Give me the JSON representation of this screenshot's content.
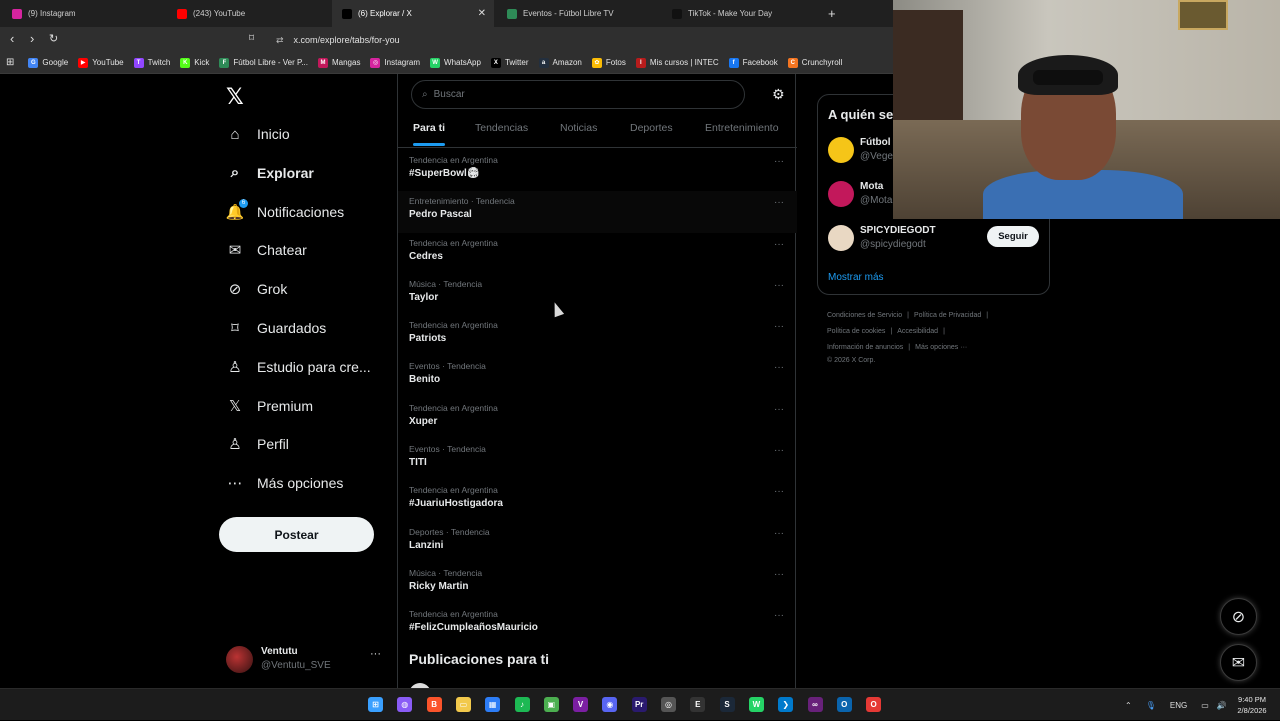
{
  "browser": {
    "tabs": [
      {
        "label": "(9) Instagram",
        "icon": "instagram-icon",
        "color": "#d6249f"
      },
      {
        "label": "(243) YouTube",
        "icon": "youtube-icon",
        "color": "#ff0000"
      },
      {
        "label": "(6) Explorar / X",
        "icon": "x-icon",
        "color": "#000000",
        "active": true,
        "close": "✕"
      },
      {
        "label": "Eventos - Fútbol Libre TV",
        "icon": "futbol-libre-icon",
        "color": "#2e8b57"
      },
      {
        "label": "TikTok - Make Your Day",
        "icon": "tiktok-icon",
        "color": "#111111"
      }
    ],
    "new_tab": "+",
    "url": "x.com/explore/tabs/for-you",
    "bookmarks": [
      {
        "label": "Google",
        "color": "#4285f4",
        "glyph": "G"
      },
      {
        "label": "YouTube",
        "color": "#ff0000",
        "glyph": "▶"
      },
      {
        "label": "Twitch",
        "color": "#9146ff",
        "glyph": "T"
      },
      {
        "label": "Kick",
        "color": "#53fc18",
        "glyph": "K"
      },
      {
        "label": "Fútbol Libre - Ver P...",
        "color": "#2e8b57",
        "glyph": "F"
      },
      {
        "label": "Mangas",
        "color": "#c2185b",
        "glyph": "M"
      },
      {
        "label": "Instagram",
        "color": "#d6249f",
        "glyph": "◎"
      },
      {
        "label": "WhatsApp",
        "color": "#25d366",
        "glyph": "W"
      },
      {
        "label": "Twitter",
        "color": "#000000",
        "glyph": "X"
      },
      {
        "label": "Amazon",
        "color": "#232f3e",
        "glyph": "a"
      },
      {
        "label": "Fotos",
        "color": "#fbbc05",
        "glyph": "✿"
      },
      {
        "label": "Mis cursos | INTEC",
        "color": "#b71c1c",
        "glyph": "I"
      },
      {
        "label": "Facebook",
        "color": "#1877f2",
        "glyph": "f"
      },
      {
        "label": "Crunchyroll",
        "color": "#f47521",
        "glyph": "C"
      }
    ]
  },
  "sidebar": {
    "items": [
      {
        "label": "Inicio",
        "icon": "home-icon",
        "glyph": "⌂"
      },
      {
        "label": "Explorar",
        "icon": "search-icon",
        "glyph": "⌕",
        "active": true
      },
      {
        "label": "Notificaciones",
        "icon": "bell-icon",
        "glyph": "🔔",
        "badge": "6"
      },
      {
        "label": "Chatear",
        "icon": "mail-icon",
        "glyph": "✉"
      },
      {
        "label": "Grok",
        "icon": "grok-icon",
        "glyph": "⊘"
      },
      {
        "label": "Guardados",
        "icon": "bookmark-icon",
        "glyph": "⌑"
      },
      {
        "label": "Estudio para cre...",
        "icon": "creator-studio-icon",
        "glyph": "♙"
      },
      {
        "label": "Premium",
        "icon": "x-premium-icon",
        "glyph": "𝕏"
      },
      {
        "label": "Perfil",
        "icon": "person-icon",
        "glyph": "♙"
      },
      {
        "label": "Más opciones",
        "icon": "more-circle-icon",
        "glyph": "⋯"
      }
    ],
    "post_button": "Postear",
    "account": {
      "name": "Ventutu",
      "handle": "@Ventutu_SVE",
      "more": "···"
    }
  },
  "explore": {
    "search_placeholder": "Buscar",
    "tabs": [
      "Para ti",
      "Tendencias",
      "Noticias",
      "Deportes",
      "Entretenimiento"
    ],
    "trends": [
      {
        "context": "Tendencia en Argentina",
        "name": "#SuperBowl🏟"
      },
      {
        "context": "Entretenimiento · Tendencia",
        "name": "Pedro Pascal"
      },
      {
        "context": "Tendencia en Argentina",
        "name": "Cedres"
      },
      {
        "context": "Música · Tendencia",
        "name": "Taylor"
      },
      {
        "context": "Tendencia en Argentina",
        "name": "Patriots"
      },
      {
        "context": "Eventos · Tendencia",
        "name": "Benito"
      },
      {
        "context": "Tendencia en Argentina",
        "name": "Xuper"
      },
      {
        "context": "Eventos · Tendencia",
        "name": "TITI"
      },
      {
        "context": "Tendencia en Argentina",
        "name": "#JuariuHostigadora"
      },
      {
        "context": "Deportes · Tendencia",
        "name": "Lanzini"
      },
      {
        "context": "Música · Tendencia",
        "name": "Ricky Martin"
      },
      {
        "context": "Tendencia en Argentina",
        "name": "#FelizCumpleañosMauricio"
      }
    ],
    "trend_more": "···",
    "posts_title": "Publicaciones para ti"
  },
  "who_to_follow": {
    "title": "A quién se",
    "accounts": [
      {
        "name": "Fútbol",
        "handle": "@Veget",
        "color": "#f5c518"
      },
      {
        "name": "Mota",
        "handle": "@Mota",
        "color": "#c2185b"
      },
      {
        "name": "SPICYDIEGODT",
        "handle": "@spicydiegodt",
        "color": "#e9d8c3",
        "follow": "Seguir"
      }
    ],
    "show_more": "Mostrar más"
  },
  "footer": {
    "links": [
      "Condiciones de Servicio",
      "Política de Privacidad",
      "Política de cookies",
      "Accesibilidad",
      "Información de anuncios",
      "Más opciones ···"
    ],
    "copyright": "© 2026 X Corp."
  },
  "taskbar": {
    "language": "ENG",
    "time": "9:40 PM",
    "date": "2/8/2026",
    "apps": [
      {
        "name": "windows-start-icon",
        "color": "#3aa0ff",
        "glyph": "⊞"
      },
      {
        "name": "copilot-icon",
        "color": "#8a5cf6",
        "glyph": "◍"
      },
      {
        "name": "brave-icon",
        "color": "#fb542b",
        "glyph": "B"
      },
      {
        "name": "file-explorer-icon",
        "color": "#f2c94c",
        "glyph": "▭"
      },
      {
        "name": "store-icon",
        "color": "#2d7df6",
        "glyph": "▦"
      },
      {
        "name": "spotify-icon",
        "color": "#1db954",
        "glyph": "♪"
      },
      {
        "name": "minecraft-icon",
        "color": "#4caf50",
        "glyph": "▣"
      },
      {
        "name": "vegas-icon",
        "color": "#7b1fa2",
        "glyph": "V"
      },
      {
        "name": "discord-icon",
        "color": "#5865f2",
        "glyph": "◉"
      },
      {
        "name": "premiere-icon",
        "color": "#2a1a6e",
        "glyph": "Pr"
      },
      {
        "name": "chrome-icon",
        "color": "#555555",
        "glyph": "◎"
      },
      {
        "name": "epic-games-icon",
        "color": "#333333",
        "glyph": "E"
      },
      {
        "name": "steam-icon",
        "color": "#1b2838",
        "glyph": "S"
      },
      {
        "name": "whatsapp-icon",
        "color": "#25d366",
        "glyph": "W"
      },
      {
        "name": "vscode-icon",
        "color": "#007acc",
        "glyph": "❯"
      },
      {
        "name": "visual-studio-icon",
        "color": "#68217a",
        "glyph": "∞"
      },
      {
        "name": "outlook-icon",
        "color": "#0a64ad",
        "glyph": "O"
      },
      {
        "name": "opera-gx-icon",
        "color": "#e53935",
        "glyph": "O"
      }
    ]
  }
}
